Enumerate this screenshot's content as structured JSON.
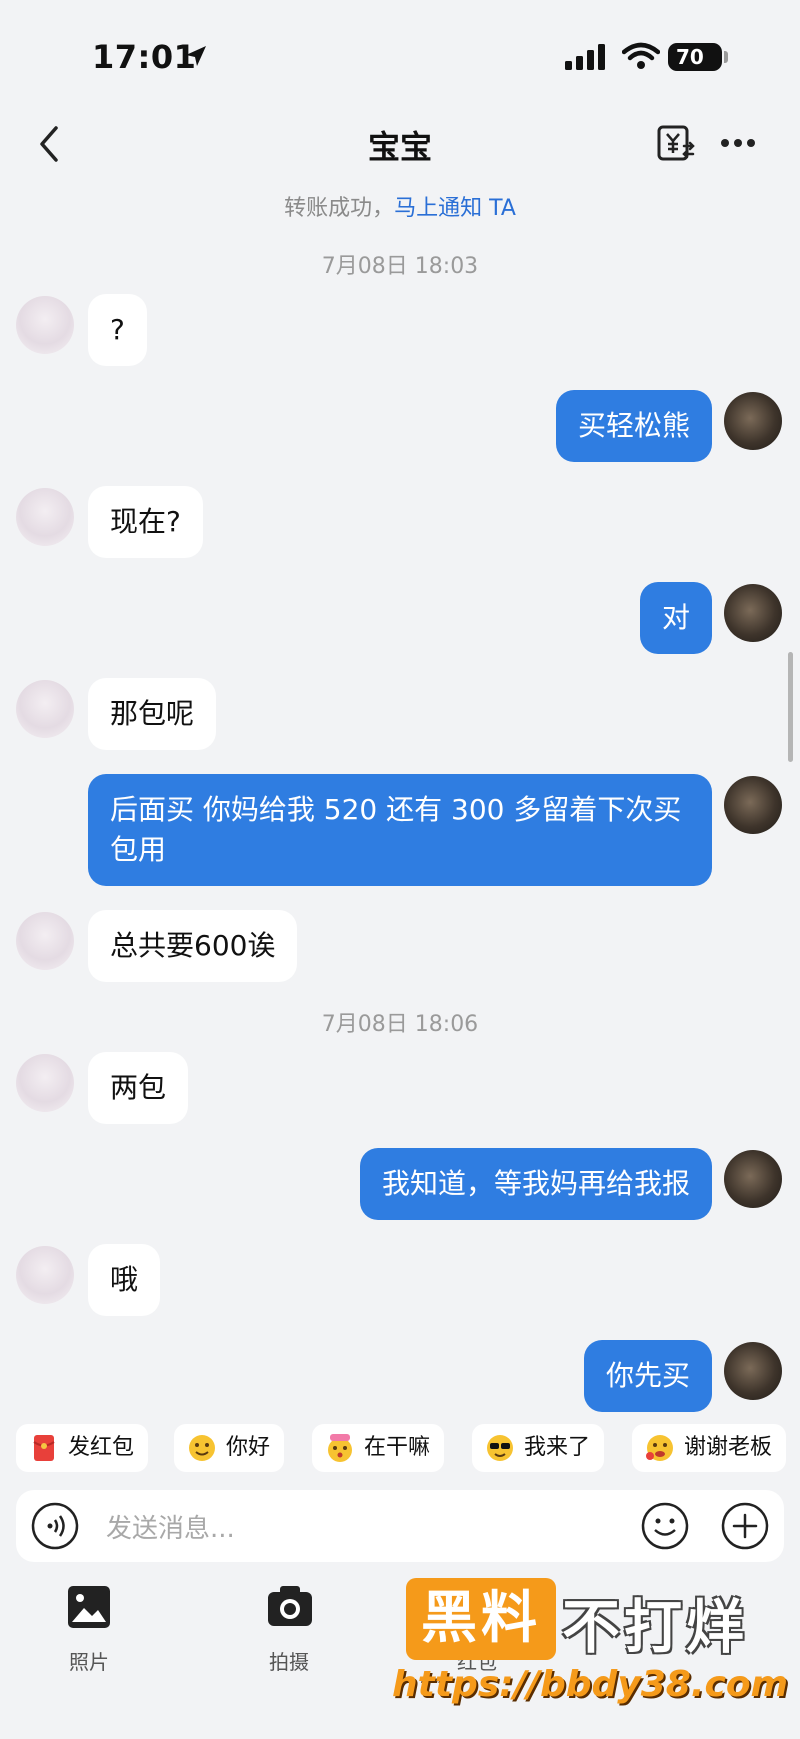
{
  "status_bar": {
    "time": "17:01",
    "battery": "70"
  },
  "header": {
    "title": "宝宝"
  },
  "notice": {
    "prefix": "转账成功，",
    "link": "马上通知 TA"
  },
  "timestamps": [
    "7月08日 18:03",
    "7月08日 18:06"
  ],
  "messages": [
    {
      "side": "left",
      "text": "?"
    },
    {
      "side": "right",
      "text": "买轻松熊"
    },
    {
      "side": "left",
      "text": "现在?"
    },
    {
      "side": "right",
      "text": "对"
    },
    {
      "side": "left",
      "text": "那包呢"
    },
    {
      "side": "right",
      "text": "后面买 你妈给我 520 还有 300 多留着下次买包用"
    },
    {
      "side": "left",
      "text": "总共要600诶"
    },
    {
      "side": "left",
      "text": "两包"
    },
    {
      "side": "right",
      "text": "我知道，等我妈再给我报"
    },
    {
      "side": "left",
      "text": "哦"
    },
    {
      "side": "right",
      "text": "你先买"
    }
  ],
  "quick_replies": [
    {
      "label": "发红包",
      "icon": "red-envelope-icon"
    },
    {
      "label": "你好",
      "icon": "hello-emoji-icon"
    },
    {
      "label": "在干嘛",
      "icon": "what-doing-emoji-icon"
    },
    {
      "label": "我来了",
      "icon": "sunglasses-emoji-icon"
    },
    {
      "label": "谢谢老板",
      "icon": "thanks-emoji-icon"
    }
  ],
  "input": {
    "placeholder": "发送消息..."
  },
  "tools": [
    {
      "label": "照片",
      "icon": "photo-icon"
    },
    {
      "label": "拍摄",
      "icon": "camera-icon"
    },
    {
      "label": "红包",
      "icon": "red-packet-icon"
    }
  ],
  "watermark": {
    "box": "黑料",
    "text": "不打烊",
    "url": "https://bbdy38.com"
  },
  "colors": {
    "accent": "#2f7de1",
    "link": "#2a6fd6",
    "background": "#f2f3f5",
    "watermark": "#f59a1a"
  }
}
